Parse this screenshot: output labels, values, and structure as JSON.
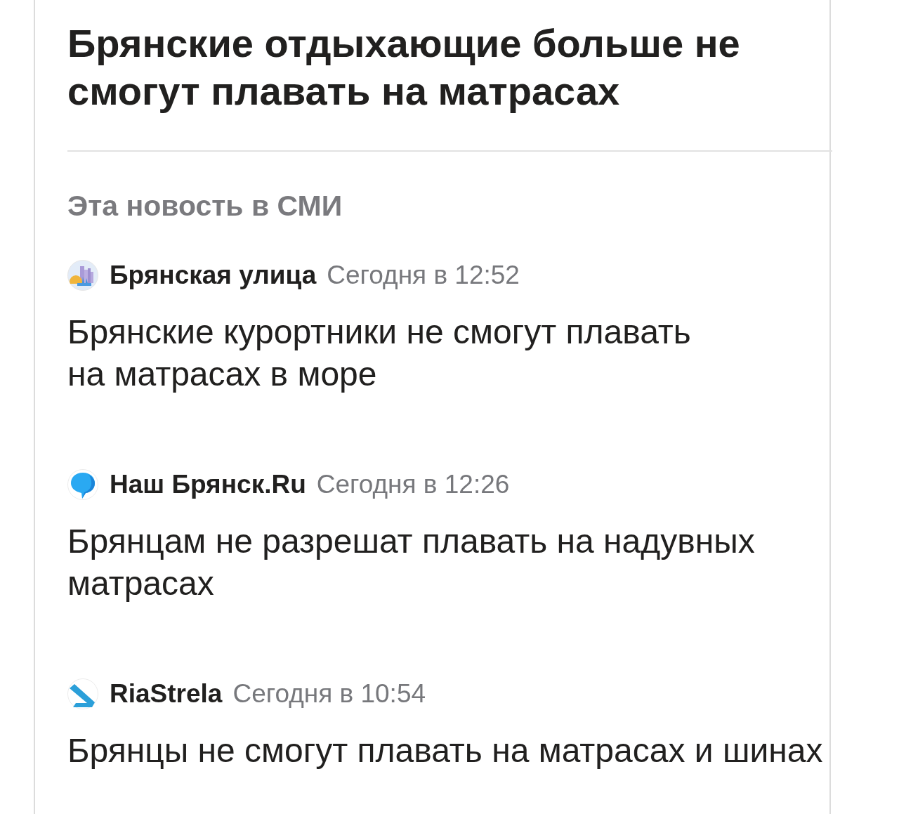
{
  "article": {
    "title": "Брянские отдыхающие больше не смогут плавать на матрасах"
  },
  "media": {
    "heading": "Эта новость в СМИ",
    "items": [
      {
        "kind": "skyline",
        "source": "Брянская улица",
        "time": "Сегодня в 12:52",
        "headline": "Брянские курортники не смогут плавать на матрасах в море"
      },
      {
        "kind": "bubble",
        "source": "Наш Брянск.Ru",
        "time": "Сегодня в 12:26",
        "headline": "Брянцам не разрешат плавать на надувных матрасах"
      },
      {
        "kind": "arrow",
        "source": "RiaStrela",
        "time": "Сегодня в 10:54",
        "headline": "Брянцы не смогут плавать на матрасах и шинах"
      }
    ]
  }
}
